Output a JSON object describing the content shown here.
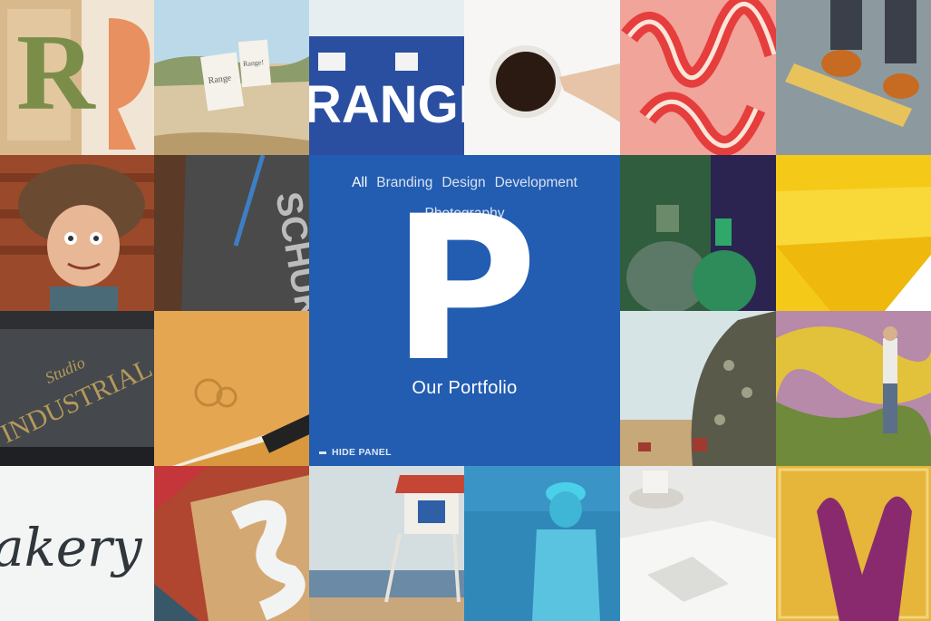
{
  "panel": {
    "filters": [
      "All",
      "Branding",
      "Design",
      "Development",
      "Photography"
    ],
    "active_filter": "All",
    "logo_letter": "P",
    "title": "Our Portfolio",
    "hide_label": "HIDE PANEL"
  },
  "photo_text": {
    "range_banner": "RANGE",
    "bakery_script": "akery",
    "sign_left": "Range",
    "sign_right": "Range!"
  },
  "colors": {
    "panel_blue": "#2462bc"
  }
}
